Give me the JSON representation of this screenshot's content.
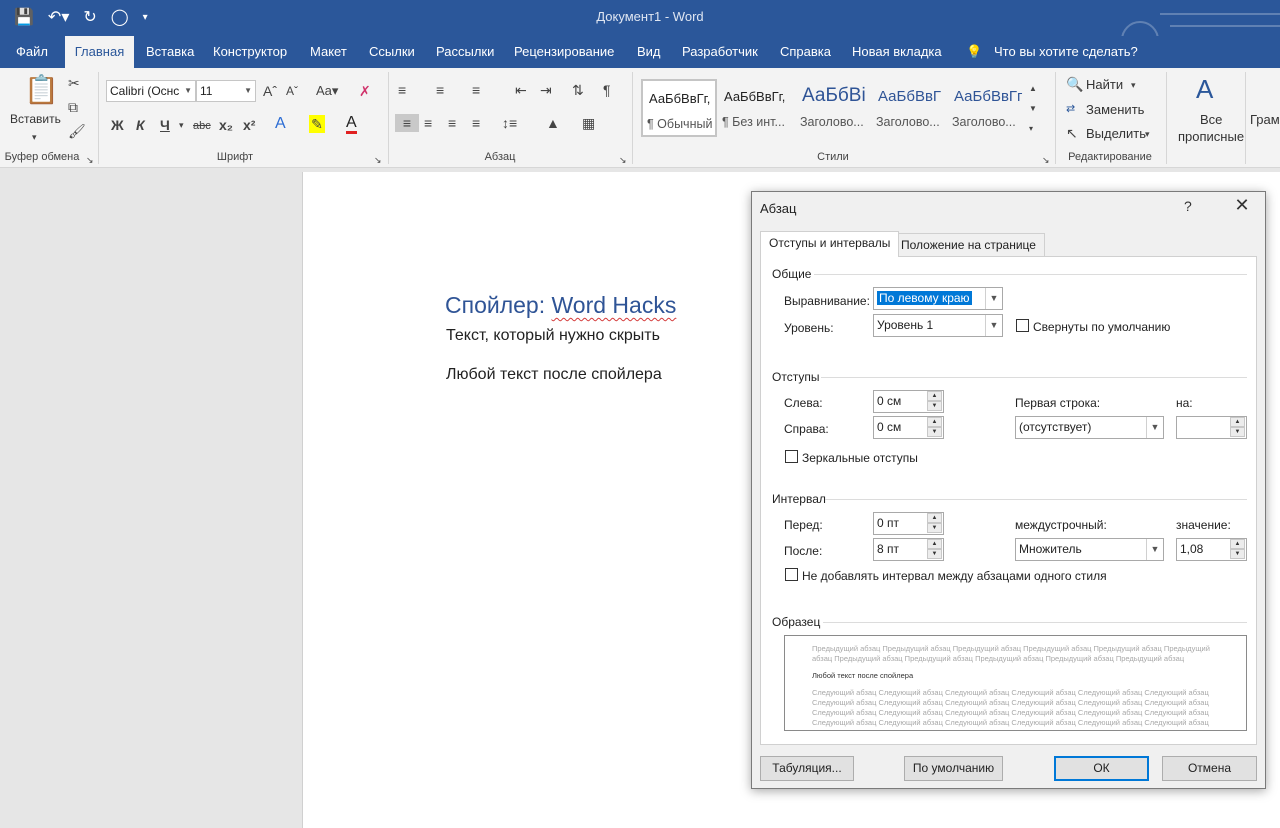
{
  "window": {
    "title": "Документ1  -  Word"
  },
  "qat": {
    "save_icon": "save-icon",
    "undo_icon": "undo-icon",
    "redo_icon": "redo-icon",
    "circle_icon": "circle-icon",
    "customize_icon": "customize-qat-icon"
  },
  "tabs": [
    {
      "label": "Файл"
    },
    {
      "label": "Главная"
    },
    {
      "label": "Вставка"
    },
    {
      "label": "Конструктор"
    },
    {
      "label": "Макет"
    },
    {
      "label": "Ссылки"
    },
    {
      "label": "Рассылки"
    },
    {
      "label": "Рецензирование"
    },
    {
      "label": "Вид"
    },
    {
      "label": "Разработчик"
    },
    {
      "label": "Справка"
    },
    {
      "label": "Новая вкладка"
    }
  ],
  "tell_me": "Что вы хотите сделать?",
  "ribbon": {
    "clipboard": {
      "paste_label": "Вставить",
      "group_label": "Буфер обмена"
    },
    "font": {
      "font_name": "Calibri (Оснс",
      "font_size": "11",
      "group_label": "Шрифт",
      "case_label": "Aa"
    },
    "paragraph": {
      "group_label": "Абзац"
    },
    "styles": {
      "group_label": "Стили",
      "items": [
        {
          "sample": "АаБбВвГг,",
          "name": "¶ Обычный"
        },
        {
          "sample": "АаБбВвГг,",
          "name": "¶ Без инт..."
        },
        {
          "sample": "АаБбВі",
          "name": "Заголово..."
        },
        {
          "sample": "АаБбВвГ",
          "name": "Заголово..."
        },
        {
          "sample": "АаБбВвГг",
          "name": "Заголово..."
        }
      ]
    },
    "editing": {
      "find": "Найти",
      "replace": "Заменить",
      "select": "Выделить",
      "group_label": "Редактирование"
    },
    "all_caps": {
      "line1": "Все",
      "line2": "прописные"
    },
    "cut_off_label": "Грам"
  },
  "document": {
    "heading_prefix": "Спойлер: ",
    "heading_wavy": "Word Hacks",
    "para1": "Текст, который нужно скрыть",
    "para2": "Любой текст после спойлера"
  },
  "dialog": {
    "title": "Абзац",
    "help": "?",
    "tab1": "Отступы и интервалы",
    "tab2": "Положение на странице",
    "general": {
      "section": "Общие",
      "alignment_label": "Выравнивание:",
      "alignment_value": "По левому краю",
      "level_label": "Уровень:",
      "level_value": "Уровень 1",
      "collapsed_label": "Свернуты по умолчанию"
    },
    "indents": {
      "section": "Отступы",
      "left_label": "Слева:",
      "left_value": "0 см",
      "right_label": "Справа:",
      "right_value": "0 см",
      "first_line_label": "Первая строка:",
      "first_line_value": "(отсутствует)",
      "by_label": "на:",
      "mirror_label": "Зеркальные отступы"
    },
    "spacing": {
      "section": "Интервал",
      "before_label": "Перед:",
      "before_value": "0 пт",
      "after_label": "После:",
      "after_value": "8 пт",
      "line_label": "междустрочный:",
      "line_value": "Множитель",
      "at_label": "значение:",
      "at_value": "1,08",
      "dont_add_label": "Не добавлять интервал между абзацами одного стиля"
    },
    "preview": {
      "section": "Образец",
      "prev1": "Предыдущий абзац Предыдущий абзац Предыдущий абзац Предыдущий абзац Предыдущий абзац Предыдущий абзац",
      "prev2": "абзац Предыдущий абзац Предыдущий абзац Предыдущий абзац Предыдущий абзац Предыдущий абзац",
      "current": "Любой текст после спойлера",
      "next": "Следующий абзац Следующий абзац Следующий абзац Следующий абзац Следующий абзац Следующий абзац"
    },
    "buttons": {
      "tabs": "Табуляция...",
      "default": "По умолчанию",
      "ok": "ОК",
      "cancel": "Отмена"
    }
  }
}
